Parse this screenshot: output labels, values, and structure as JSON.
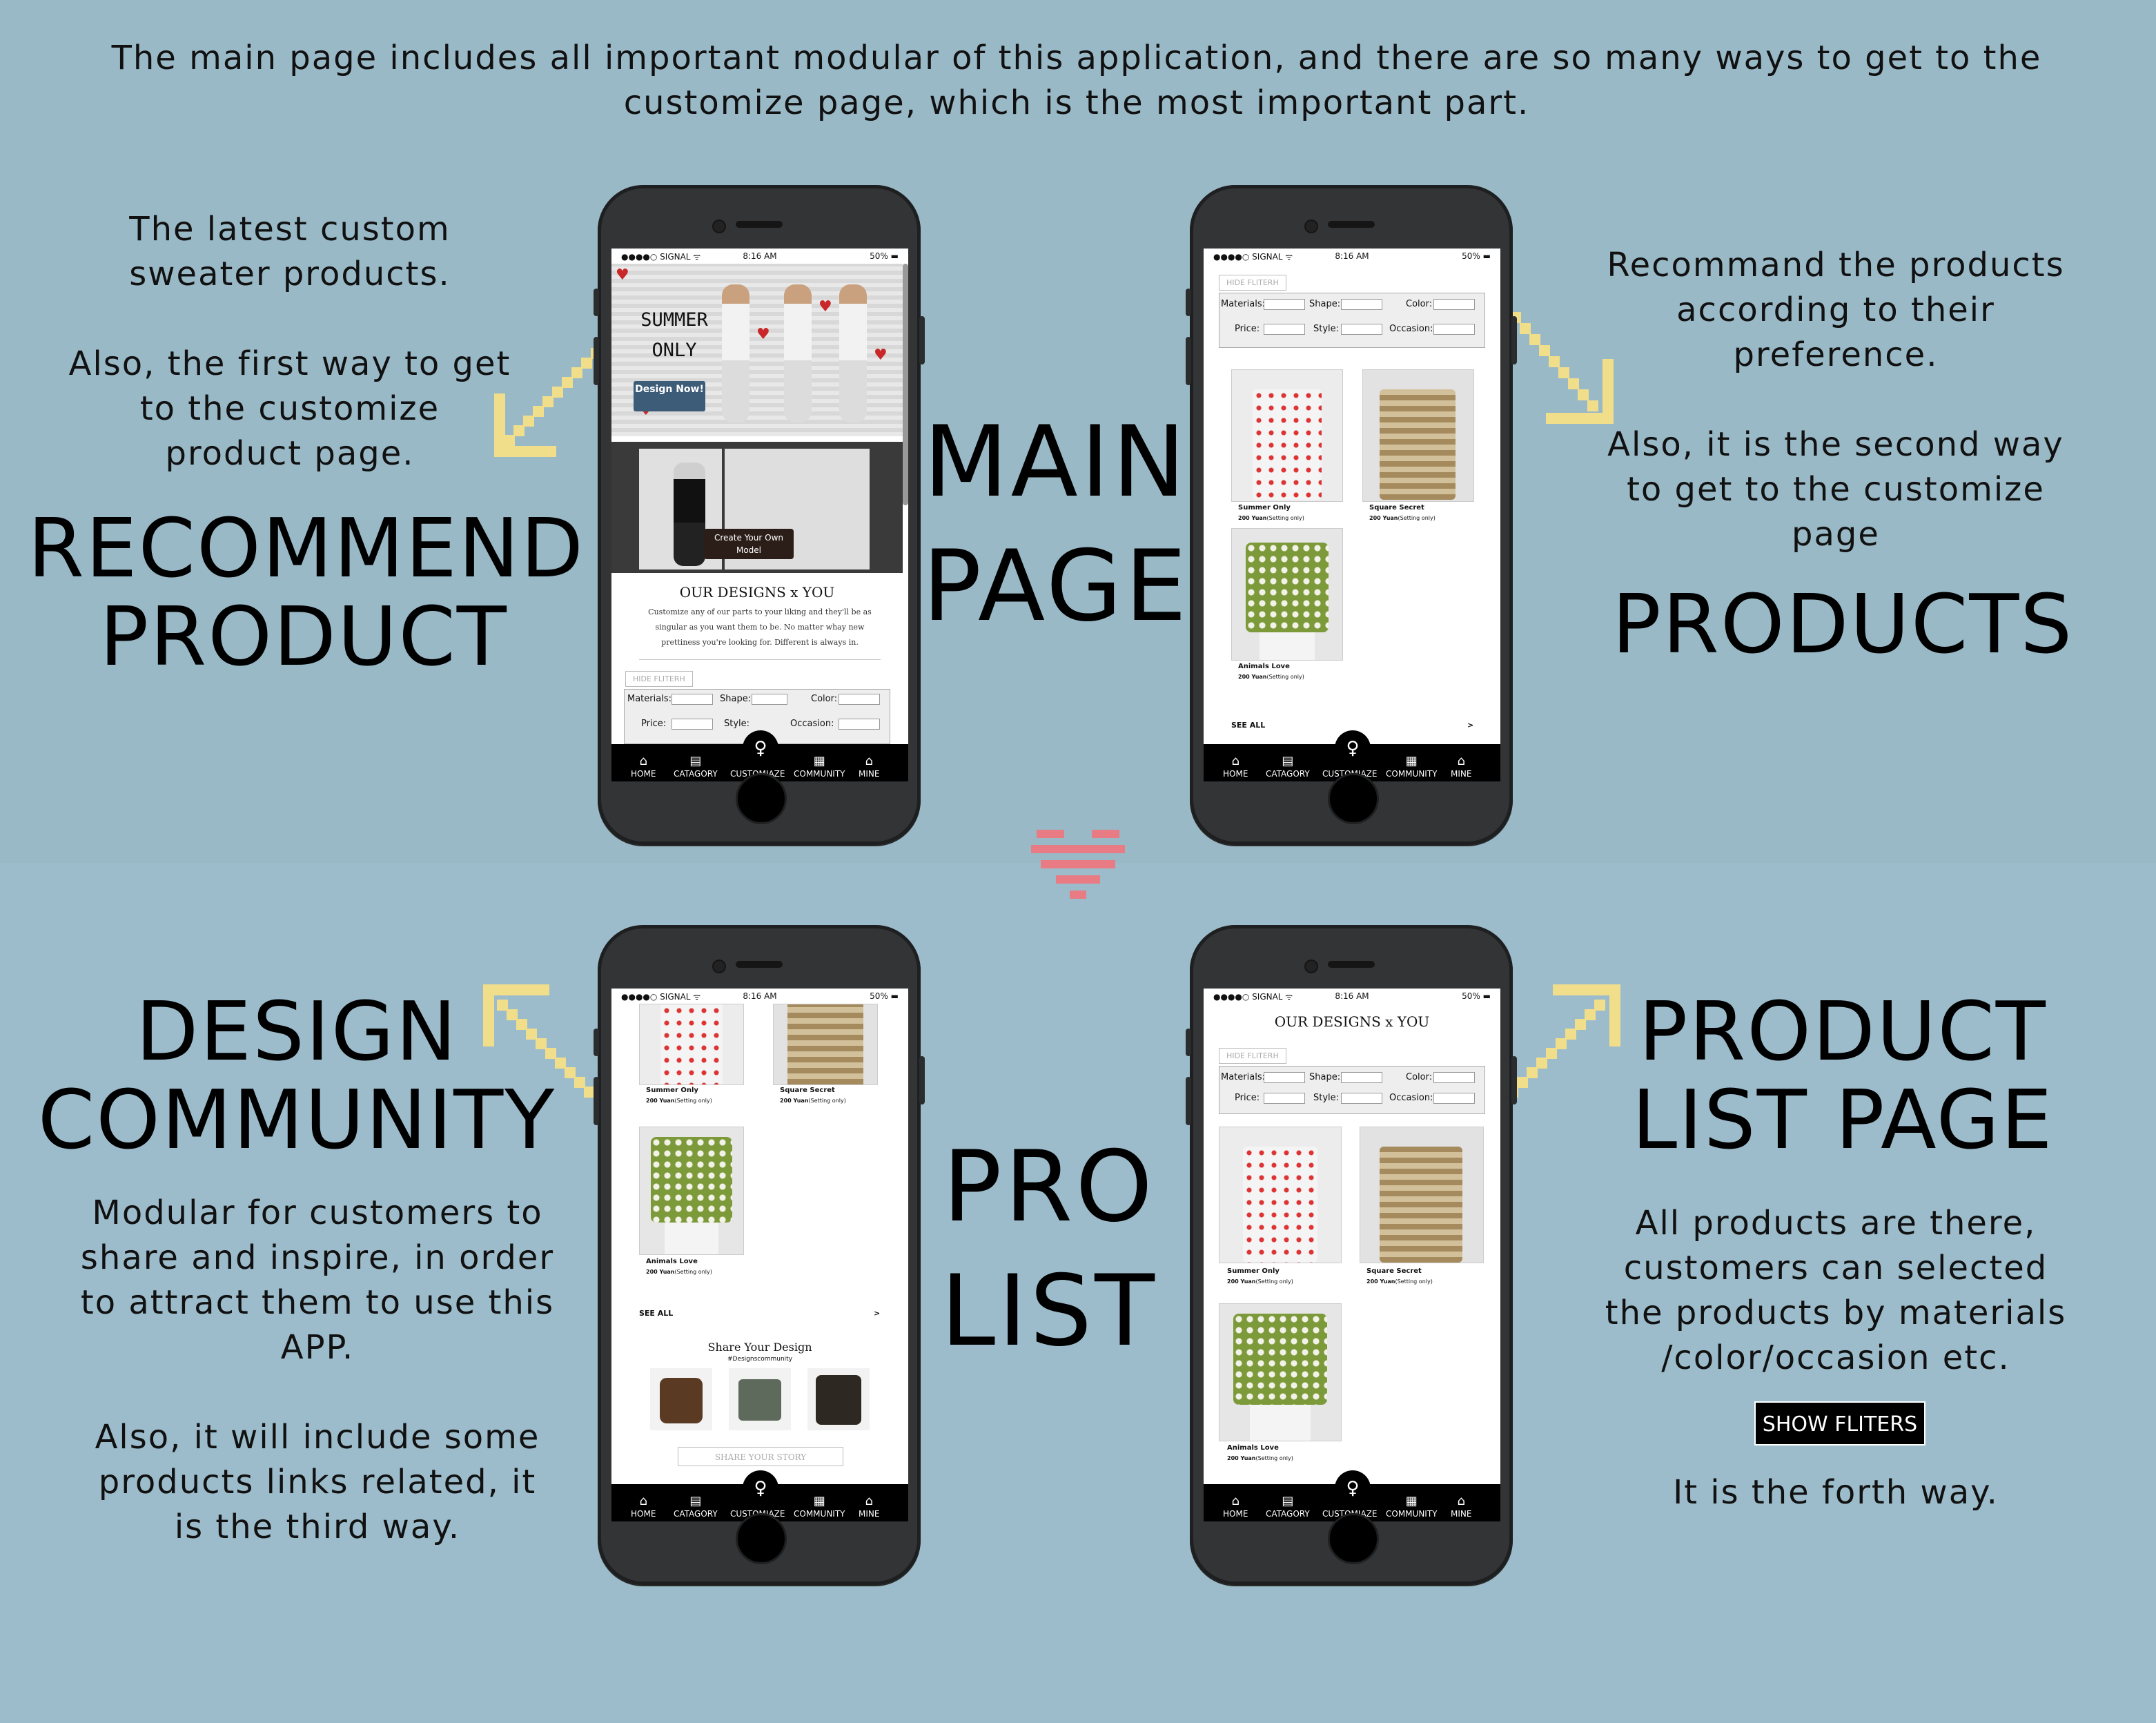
{
  "intro": {
    "line1": "The main page includes all important modular of this application, and there are so many ways to get to the",
    "line2": "customize page, which is the most important part."
  },
  "center": {
    "main_line1": "MAIN",
    "main_line2": "PAGE",
    "pro_line1": "PRO",
    "pro_line2": "LIST"
  },
  "recommend": {
    "desc1_line1": "The latest custom",
    "desc1_line2": "sweater products.",
    "desc2_line1": "Also, the first way to get",
    "desc2_line2": "to the customize",
    "desc2_line3": "product page.",
    "title_line1": "RECOMMEND",
    "title_line2": "PRODUCT"
  },
  "products": {
    "desc1_line1": "Recommand the products",
    "desc1_line2": "according to their",
    "desc1_line3": "preference.",
    "desc2_line1": "Also, it is the second way",
    "desc2_line2": "to get to the customize",
    "desc2_line3": "page",
    "title": "PRODUCTS"
  },
  "community": {
    "title_line1": "DESIGN",
    "title_line2": "COMMUNITY",
    "desc1_line1": "Modular for customers to",
    "desc1_line2": "share and inspire, in order",
    "desc1_line3": "to attract them to use this",
    "desc1_line4": "APP.",
    "desc2_line1": "Also, it will include some",
    "desc2_line2": "products links related, it",
    "desc2_line3": "is the third way."
  },
  "product_list": {
    "title_line1": "PRODUCT",
    "title_line2": "LIST PAGE",
    "desc_line1": "All products are there,",
    "desc_line2": "customers can selected",
    "desc_line3": "the products by materials",
    "desc_line4": "/color/occasion etc.",
    "button": "SHOW FLITERS",
    "footer": "It is the forth way."
  },
  "phone": {
    "carrier": "●●●●○ SIGNAL  ᯤ",
    "time": "8:16 AM",
    "battery": "50% ▬",
    "tabs": [
      "HOME",
      "CATAGORY",
      "CUSTOMIAZE",
      "COMMUNITY",
      "MINE"
    ],
    "banner_line1": "SUMMER",
    "banner_line2": "ONLY",
    "design_now": "Design Now!",
    "create_model": "Create Your Own Model",
    "our_designs": "OUR DESIGNS x YOU",
    "designs_blurb": "Customize any of our parts to your liking and they'll be as singular as you want them to be. No matter whay new prettiness you're looking for. Different is always in.",
    "hide_filter": "HIDE FLITERH",
    "filter_labels": {
      "materials": "Materials:",
      "shape": "Shape:",
      "color": "Color:",
      "price": "Price:",
      "style": "Style:",
      "occasion": "Occasion:"
    },
    "products": [
      {
        "name": "Summer Only",
        "price": "200 Yuan",
        "note": "(Setting only)"
      },
      {
        "name": "Square Secret",
        "price": "200 Yuan",
        "note": "(Setting only)"
      },
      {
        "name": "Animals Love",
        "price": "200 Yuan",
        "note": "(Setting only)"
      }
    ],
    "see_all": "SEE ALL",
    "see_all_arrow": ">",
    "share_title": "Share Your Design",
    "share_handle": "#Designscommunity",
    "share_story": "SHARE YOUR STORY"
  },
  "colors": {
    "background": "#99b9c7",
    "arrow": "#f1de8a",
    "heart": "#e87b84",
    "phone": "#333436"
  }
}
